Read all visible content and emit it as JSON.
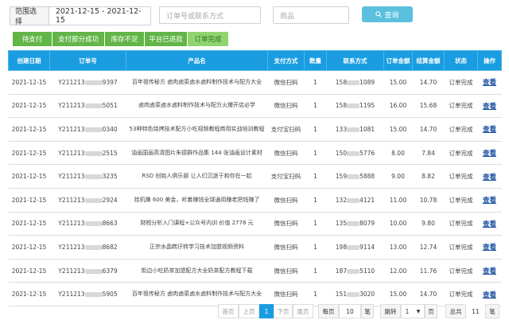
{
  "filters": {
    "range_label": "范围选择",
    "range_value": "2021-12-15 - 2021-12-15",
    "order_placeholder": "订单号或联系方式",
    "product_placeholder": "商品",
    "search_label": "查询"
  },
  "tabs": [
    {
      "label": "待支付"
    },
    {
      "label": "支付部分成功"
    },
    {
      "label": "库存不足"
    },
    {
      "label": "平台已退款"
    },
    {
      "label": "订单完成"
    }
  ],
  "table": {
    "headers": [
      "创建日期",
      "订单号",
      "产品名",
      "支付方式",
      "数量",
      "联系方式",
      "订单金额",
      "结算金额",
      "状态",
      "操作"
    ],
    "rows": [
      {
        "date": "2021-12-15",
        "order_pre": "Y211213",
        "order_suf": "9397",
        "product": "百年祖传秘方 卤肉卤菜卤水卤料制作技术与配方大全",
        "pay": "微信扫码",
        "qty": "1",
        "phone_pre": "158",
        "phone_suf": "1089",
        "amount": "15.00",
        "settle": "14.70",
        "status": "订单完成",
        "action": "查看"
      },
      {
        "date": "2021-12-15",
        "order_pre": "Y211213",
        "order_suf": "5051",
        "product": "卤肉卤菜卤水卤料制作技术与配方火爆开店必学",
        "pay": "微信扫码",
        "qty": "1",
        "phone_pre": "158",
        "phone_suf": "1195",
        "amount": "16.00",
        "settle": "15.68",
        "status": "订单完成",
        "action": "查看"
      },
      {
        "date": "2021-12-15",
        "order_pre": "Y211213",
        "order_suf": "0340",
        "product": "53种特色烧烤技术配方小吃视频教程商用实战培训教程",
        "pay": "支付宝扫码",
        "qty": "1",
        "phone_pre": "133",
        "phone_suf": "1081",
        "amount": "15.00",
        "settle": "14.70",
        "status": "订单完成",
        "action": "查看"
      },
      {
        "date": "2021-12-15",
        "order_pre": "Y211213",
        "order_suf": "2515",
        "product": "油画国画高清图片朱德群作品集 144 张油画设计素材",
        "pay": "微信扫码",
        "qty": "1",
        "phone_pre": "150",
        "phone_suf": "5776",
        "amount": "8.00",
        "settle": "7.84",
        "status": "订单完成",
        "action": "查看"
      },
      {
        "date": "2021-12-15",
        "order_pre": "Y211213",
        "order_suf": "3235",
        "product": "RSD 创始人俱乐部 让人们沉迷于和你在一起",
        "pay": "支付宝扫码",
        "qty": "1",
        "phone_pre": "159",
        "phone_suf": "5888",
        "amount": "9.00",
        "settle": "8.82",
        "status": "订单完成",
        "action": "查看"
      },
      {
        "date": "2021-12-15",
        "order_pre": "Y211213",
        "order_suf": "2924",
        "product": "挂机赚 600 美金，听着赚钱全球通用赚老把钱赚了",
        "pay": "微信扫码",
        "qty": "1",
        "phone_pre": "132",
        "phone_suf": "4121",
        "amount": "11.00",
        "settle": "10.78",
        "status": "订单完成",
        "action": "查看"
      },
      {
        "date": "2021-12-15",
        "order_pre": "Y211213",
        "order_suf": "8663",
        "product": "财税分析入门课程+公众号内训 价值 2778 元",
        "pay": "微信扫码",
        "qty": "1",
        "phone_pre": "135",
        "phone_suf": "8079",
        "amount": "10.00",
        "settle": "9.80",
        "status": "订单完成",
        "action": "查看"
      },
      {
        "date": "2021-12-15",
        "order_pre": "Y211213",
        "order_suf": "8682",
        "product": "正宗水晶糕仔转学习技术加盟视频资料",
        "pay": "微信扫码",
        "qty": "1",
        "phone_pre": "198",
        "phone_suf": "9114",
        "amount": "13.00",
        "settle": "12.74",
        "status": "订单完成",
        "action": "查看"
      },
      {
        "date": "2021-12-15",
        "order_pre": "Y211213",
        "order_suf": "6379",
        "product": "街边小吃奶茶加盟配方大全奶茶配方教程下载",
        "pay": "微信扫码",
        "qty": "1",
        "phone_pre": "187",
        "phone_suf": "5110",
        "amount": "12.00",
        "settle": "11.76",
        "status": "订单完成",
        "action": "查看"
      },
      {
        "date": "2021-12-15",
        "order_pre": "Y211213",
        "order_suf": "5905",
        "product": "百年祖传秘方 卤肉卤菜卤水卤料制作技术与配方大全",
        "pay": "微信扫码",
        "qty": "1",
        "phone_pre": "151",
        "phone_suf": "3020",
        "amount": "15.00",
        "settle": "14.70",
        "status": "订单完成",
        "action": "查看"
      }
    ]
  },
  "pager": {
    "first": "首页",
    "prev": "上页",
    "current": "1",
    "next": "下页",
    "last": "尾页",
    "per_page_label": "每页",
    "per_page_value": "10",
    "per_page_unit": "笔",
    "jump_label": "跳转",
    "jump_value": "1",
    "jump_unit": "页",
    "total_label": "总共",
    "total_value": "11",
    "total_unit": "笔"
  },
  "colors": {
    "accent": "#1a9de0",
    "tab_green": "#62b547",
    "search_button": "#5bc0de"
  }
}
